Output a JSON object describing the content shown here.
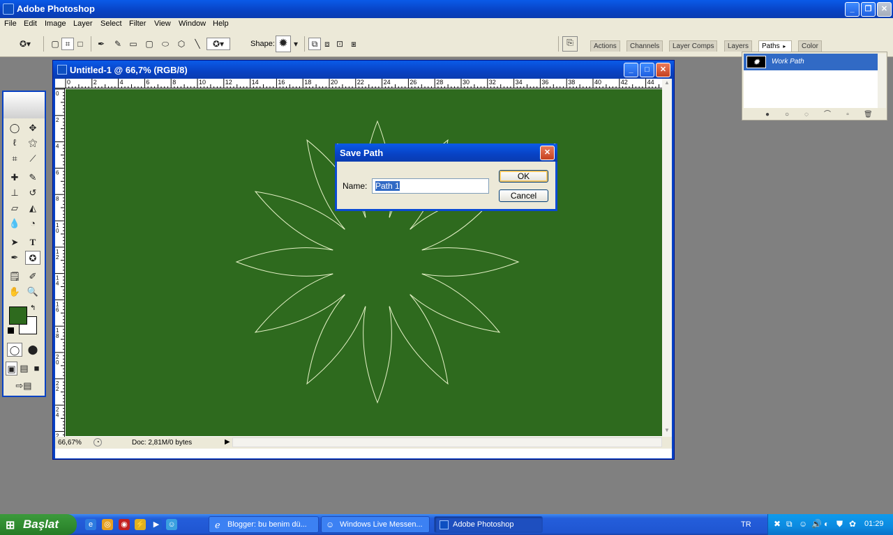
{
  "app": {
    "title": "Adobe Photoshop"
  },
  "menu": [
    "File",
    "Edit",
    "Image",
    "Layer",
    "Select",
    "Filter",
    "View",
    "Window",
    "Help"
  ],
  "options": {
    "shape_label": "Shape:"
  },
  "palette_tabs": [
    "Actions",
    "Channels",
    "Layer Comps",
    "Layers",
    "Paths",
    "Color"
  ],
  "paths_panel": {
    "item": "Work Path"
  },
  "document": {
    "title": "Untitled-1 @ 66,7% (RGB/8)",
    "zoom": "66,67%",
    "doc_info": "Doc: 2,81M/0 bytes",
    "canvas_color": "#2e6a1e",
    "ruler_top": [
      "0",
      "2",
      "4",
      "6",
      "8",
      "10",
      "12",
      "14",
      "16",
      "18",
      "20",
      "22",
      "24",
      "26",
      "28",
      "30",
      "32",
      "34",
      "36",
      "38",
      "40",
      "42",
      "44"
    ],
    "ruler_left": [
      "0",
      "2",
      "4",
      "6",
      "8",
      "10",
      "12",
      "14",
      "16",
      "18",
      "20",
      "22",
      "24",
      "26"
    ]
  },
  "dialog": {
    "title": "Save Path",
    "name_label": "Name:",
    "name_value": "Path 1",
    "ok": "OK",
    "cancel": "Cancel"
  },
  "taskbar": {
    "start": "Başlat",
    "tasks": [
      "Blogger: bu benim dü...",
      "Windows Live Messen...",
      "Adobe Photoshop"
    ],
    "lang": "TR",
    "clock": "01:29"
  },
  "colors": {
    "accent": "#0842c4",
    "selection": "#316ac5",
    "start_green": "#2f8a2f"
  }
}
